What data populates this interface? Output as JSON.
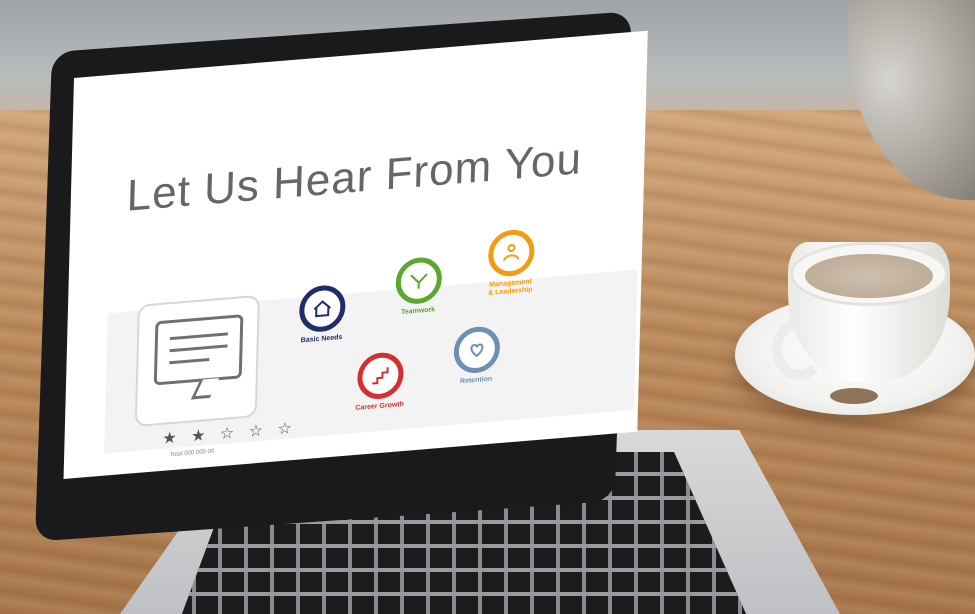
{
  "screen": {
    "title": "Let Us Hear From You",
    "feedback": {
      "stars_filled": 2,
      "stars_total": 5,
      "star_glyphs": "★ ★ ☆ ☆ ☆",
      "total_label": "Total 000 000 00"
    },
    "categories": [
      {
        "label": "Basic Needs",
        "color": "#1f2d6b",
        "icon": "people-house-icon"
      },
      {
        "label": "Teamwork",
        "color": "#5aa82c",
        "icon": "hands-together-icon"
      },
      {
        "label": "Management\n& Leadership",
        "color": "#f39c12",
        "icon": "team-presentation-icon"
      },
      {
        "label": "Career Growth",
        "color": "#d32f2f",
        "icon": "stairs-climb-icon"
      },
      {
        "label": "Retention",
        "color": "#6d8fb5",
        "icon": "heart-hand-icon"
      }
    ]
  }
}
